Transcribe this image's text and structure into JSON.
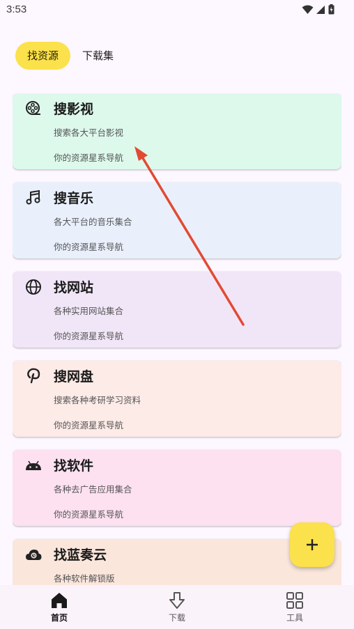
{
  "status": {
    "time": "3:53"
  },
  "tabs": [
    {
      "label": "找资源",
      "active": true
    },
    {
      "label": "下载集",
      "active": false
    }
  ],
  "cards": [
    {
      "title": "搜影视",
      "subtitle": "搜索各大平台影视",
      "footer": "你的资源星系导航",
      "icon": "film-reel-icon",
      "bg": "#ddf9ec"
    },
    {
      "title": "搜音乐",
      "subtitle": "各大平台的音乐集合",
      "footer": "你的资源星系导航",
      "icon": "music-note-icon",
      "bg": "#e9f0fc"
    },
    {
      "title": "找网站",
      "subtitle": "各种实用网站集合",
      "footer": "你的资源星系导航",
      "icon": "globe-icon",
      "bg": "#f1e6f7"
    },
    {
      "title": "搜网盘",
      "subtitle": "搜索各种考研学习资料",
      "footer": "你的资源星系导航",
      "icon": "pinterest-icon",
      "bg": "#fdebe7"
    },
    {
      "title": "找软件",
      "subtitle": "各种去广告应用集合",
      "footer": "你的资源星系导航",
      "icon": "android-icon",
      "bg": "#fde1f1"
    },
    {
      "title": "找蓝奏云",
      "subtitle": "各种软件解锁版",
      "footer": "",
      "icon": "cloud-icon",
      "bg": "#fbe6dc"
    }
  ],
  "fab": {
    "label": "+"
  },
  "nav": [
    {
      "label": "首页",
      "icon": "home-icon",
      "active": true
    },
    {
      "label": "下载",
      "icon": "download-icon",
      "active": false
    },
    {
      "label": "工具",
      "icon": "grid-icon",
      "active": false
    }
  ],
  "colors": {
    "accent": "#fbe14b",
    "arrow": "#e24a32",
    "background": "#fdf7ff"
  }
}
